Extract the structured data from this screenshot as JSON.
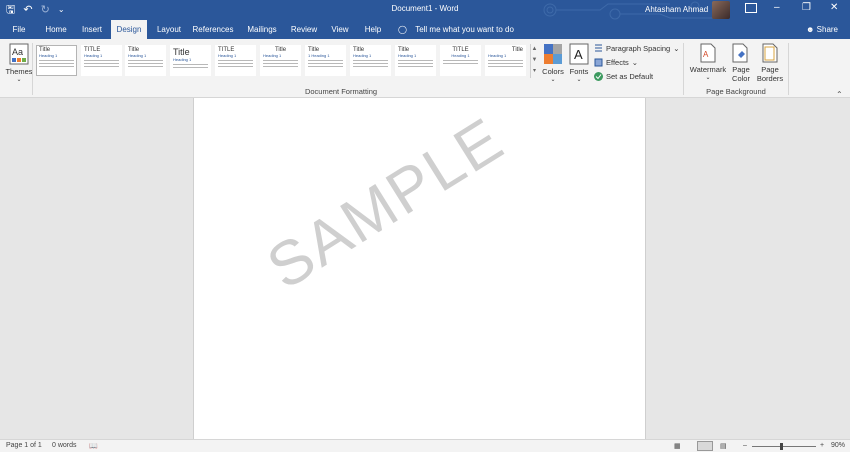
{
  "app": {
    "document_title": "Document1  -  Word",
    "user_name": "Ahtasham Ahmad"
  },
  "tabs": [
    {
      "label": "File"
    },
    {
      "label": "Home"
    },
    {
      "label": "Insert"
    },
    {
      "label": "Design"
    },
    {
      "label": "Layout"
    },
    {
      "label": "References"
    },
    {
      "label": "Mailings"
    },
    {
      "label": "Review"
    },
    {
      "label": "View"
    },
    {
      "label": "Help"
    }
  ],
  "active_tab": "Design",
  "tell_me": "Tell me what you want to do",
  "share": "Share",
  "ribbon": {
    "themes_label": "Themes",
    "styles_gallery": [
      {
        "title": "Title",
        "heading": "Heading 1"
      },
      {
        "title": "TITLE",
        "heading": "Heading 1"
      },
      {
        "title": "Title",
        "heading": "Heading 1"
      },
      {
        "title": "Title",
        "heading": "Heading 1"
      },
      {
        "title": "TITLE",
        "heading": "Heading 1"
      },
      {
        "title": "Title",
        "heading": "Heading 1"
      },
      {
        "title": "Title",
        "heading": "1  Heading 1"
      },
      {
        "title": "Title",
        "heading": "Heading 1"
      },
      {
        "title": "Title",
        "heading": "Heading 1"
      },
      {
        "title": "TITLE",
        "heading": "Heading 1"
      },
      {
        "title": "Title",
        "heading": "Heading 1"
      }
    ],
    "colors_label": "Colors",
    "fonts_label": "Fonts",
    "paragraph_spacing_label": "Paragraph Spacing",
    "effects_label": "Effects",
    "set_default_label": "Set as Default",
    "document_formatting_group": "Document Formatting",
    "watermark_label": "Watermark",
    "page_color_label_1": "Page",
    "page_color_label_2": "Color",
    "page_borders_label_1": "Page",
    "page_borders_label_2": "Borders",
    "page_background_group": "Page Background"
  },
  "document": {
    "watermark_text": "SAMPLE"
  },
  "status": {
    "page": "Page 1 of 1",
    "words": "0 words",
    "zoom": "90%",
    "zoom_level_percent": 90
  },
  "colors": {
    "brand": "#2b579a"
  }
}
